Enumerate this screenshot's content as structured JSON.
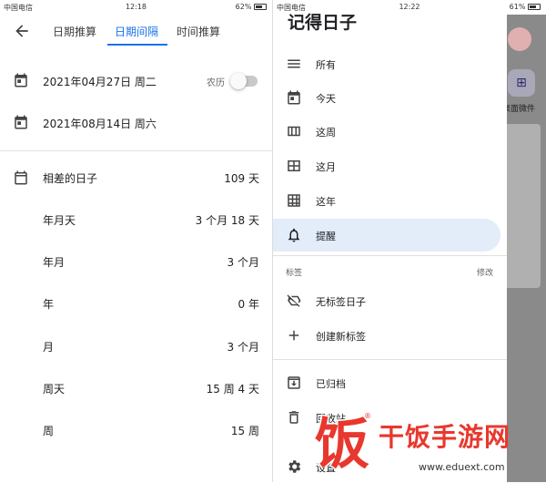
{
  "left": {
    "status": {
      "carrier": "中国电信",
      "time": "12:18",
      "battery": "62%"
    },
    "tabs": [
      {
        "label": "日期推算",
        "active": false
      },
      {
        "label": "日期间隔",
        "active": true
      },
      {
        "label": "时间推算",
        "active": false
      }
    ],
    "start_date": "2021年04月27日 周二",
    "lunar_label": "农历",
    "lunar_toggle_on": false,
    "end_date": "2021年08月14日 周六",
    "results": [
      {
        "label": "相差的日子",
        "value": "109 天"
      },
      {
        "label": "年月天",
        "value": "3 个月 18 天"
      },
      {
        "label": "年月",
        "value": "3 个月"
      },
      {
        "label": "年",
        "value": "0 年"
      },
      {
        "label": "月",
        "value": "3 个月"
      },
      {
        "label": "周天",
        "value": "15 周 4 天"
      },
      {
        "label": "周",
        "value": "15 周"
      }
    ]
  },
  "right": {
    "status": {
      "carrier": "中国电信",
      "time": "12:22",
      "battery": "61%"
    },
    "drawer_title": "记得日子",
    "menu": [
      {
        "label": "所有",
        "icon": "list-icon",
        "active": false
      },
      {
        "label": "今天",
        "icon": "calendar-day-icon",
        "active": false
      },
      {
        "label": "这周",
        "icon": "calendar-week-icon",
        "active": false
      },
      {
        "label": "这月",
        "icon": "calendar-month-icon",
        "active": false
      },
      {
        "label": "这年",
        "icon": "calendar-year-icon",
        "active": false
      },
      {
        "label": "提醒",
        "icon": "bell-icon",
        "active": true
      }
    ],
    "tags_section": "标签",
    "tags_edit": "修改",
    "tag_items": [
      {
        "label": "无标签日子",
        "icon": "label-off-icon"
      },
      {
        "label": "创建新标签",
        "icon": "plus-icon"
      }
    ],
    "archive": "已归档",
    "trash": "回收站",
    "settings": "设置",
    "background_widget_label": "桌面微件"
  },
  "watermark": {
    "logo_char": "饭",
    "title": "干饭手游网",
    "url": "www.eduext.com",
    "reg": "®",
    "color": "#e8382e"
  },
  "colors": {
    "accent": "#1a73e8",
    "active_bg": "#e3ecf9"
  }
}
